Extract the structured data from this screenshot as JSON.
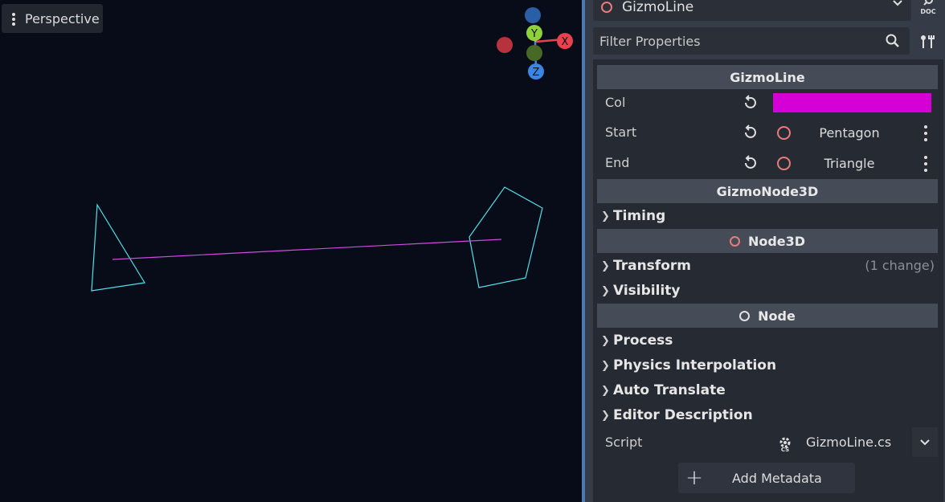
{
  "viewport": {
    "view_menu_label": "Perspective",
    "gizmo": {
      "x_label": "X",
      "y_label": "Y",
      "z_label": "Z"
    },
    "colors": {
      "background": "#080c19",
      "outline": "#4fe0e8",
      "line": "#d14be0"
    }
  },
  "inspector": {
    "selected_node": "GizmoLine",
    "doc_label": "DOC",
    "filter_placeholder": "Filter Properties",
    "sections": {
      "gizmo_line": "GizmoLine",
      "gizmo_node_3d": "GizmoNode3D",
      "node_3d": "Node3D",
      "node": "Node"
    },
    "props": {
      "col_label": "Col",
      "col_value": "#d500d6",
      "start_label": "Start",
      "start_value": "Pentagon",
      "end_label": "End",
      "end_value": "Triangle"
    },
    "groups": {
      "timing": "Timing",
      "transform": "Transform",
      "transform_changes": "(1 change)",
      "visibility": "Visibility",
      "process": "Process",
      "physics_interpolation": "Physics Interpolation",
      "auto_translate": "Auto Translate",
      "editor_description": "Editor Description"
    },
    "script_label": "Script",
    "script_value": "GizmoLine.cs",
    "add_metadata_label": "Add Metadata"
  }
}
